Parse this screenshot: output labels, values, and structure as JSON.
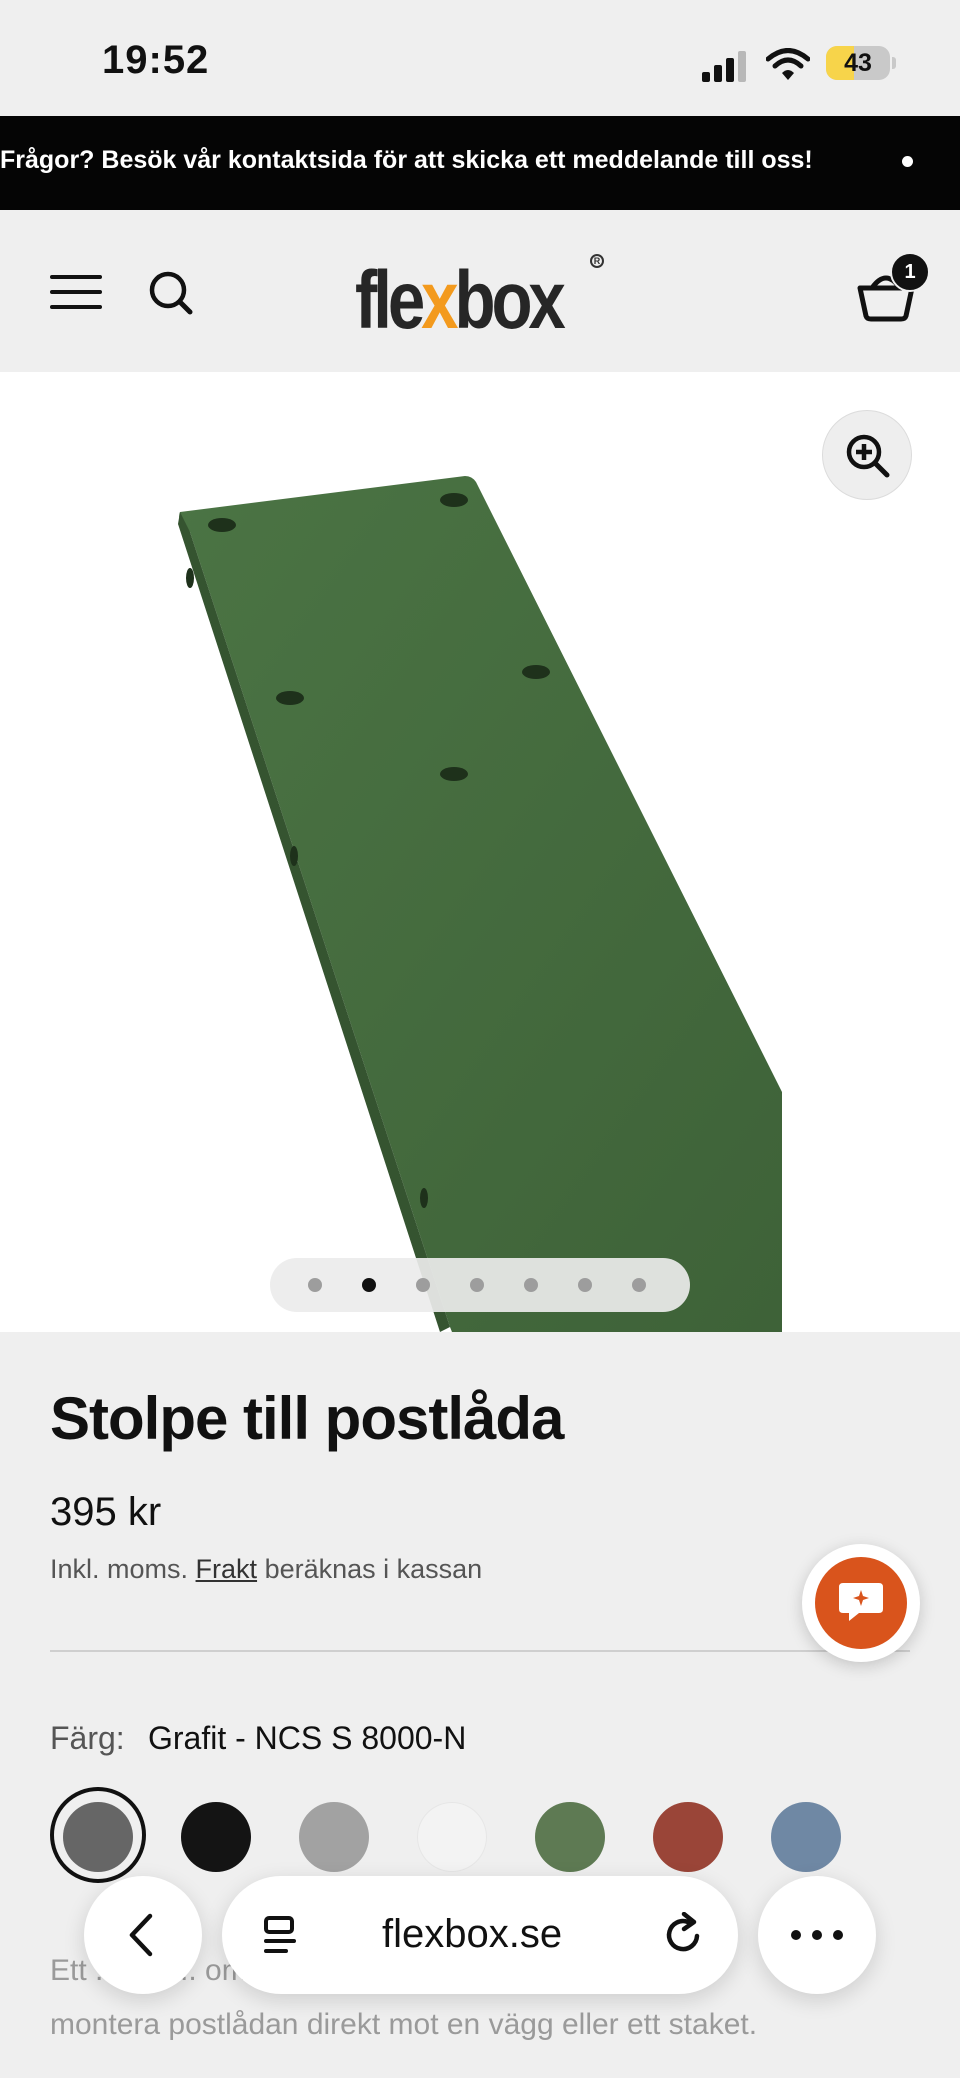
{
  "status_bar": {
    "time": "19:52",
    "battery_percent": 43
  },
  "announcement": {
    "text": "Frågor? Besök vår kontaktsida för att skicka ett meddelande till oss!"
  },
  "header": {
    "menu_icon": "hamburger-menu-icon",
    "search_icon": "search-icon",
    "logo": {
      "pre": "fle",
      "accent": "x",
      "post": "box",
      "accent_color": "#f39a1d"
    },
    "cart_icon": "basket-icon",
    "cart_count": "1"
  },
  "gallery": {
    "zoom_icon": "zoom-in-icon",
    "slide_count": 7,
    "active_slide": 2,
    "product_color": "#456b3f"
  },
  "product": {
    "title": "Stolpe till postlåda",
    "price": "395 kr",
    "tax_prefix": "Inkl. moms.",
    "shipping_link": "Frakt",
    "tax_suffix": "beräknas i kassan",
    "color_label": "Färg:",
    "color_value": "Grafit - NCS S 8000-N",
    "swatches": [
      {
        "hex": "#666666"
      },
      {
        "hex": "#141414"
      },
      {
        "hex": "#a2a2a2"
      },
      {
        "hex": "#f3f3f3"
      },
      {
        "hex": "#5e7a53"
      },
      {
        "hex": "#9a4538"
      },
      {
        "hex": "#6f88a4"
      }
    ],
    "selected_swatch": 0,
    "description_line1": "Ett ... för ... om ... vill",
    "description_line2": "montera postlådan direkt mot en vägg eller ett staket."
  },
  "chat": {
    "icon": "chat-bubble-icon",
    "color": "#d9541c"
  },
  "browser": {
    "back_icon": "chevron-left-icon",
    "reader_icon": "reader-mode-icon",
    "url": "flexbox.se",
    "reload_icon": "reload-icon",
    "more_icon": "ellipsis-icon"
  }
}
